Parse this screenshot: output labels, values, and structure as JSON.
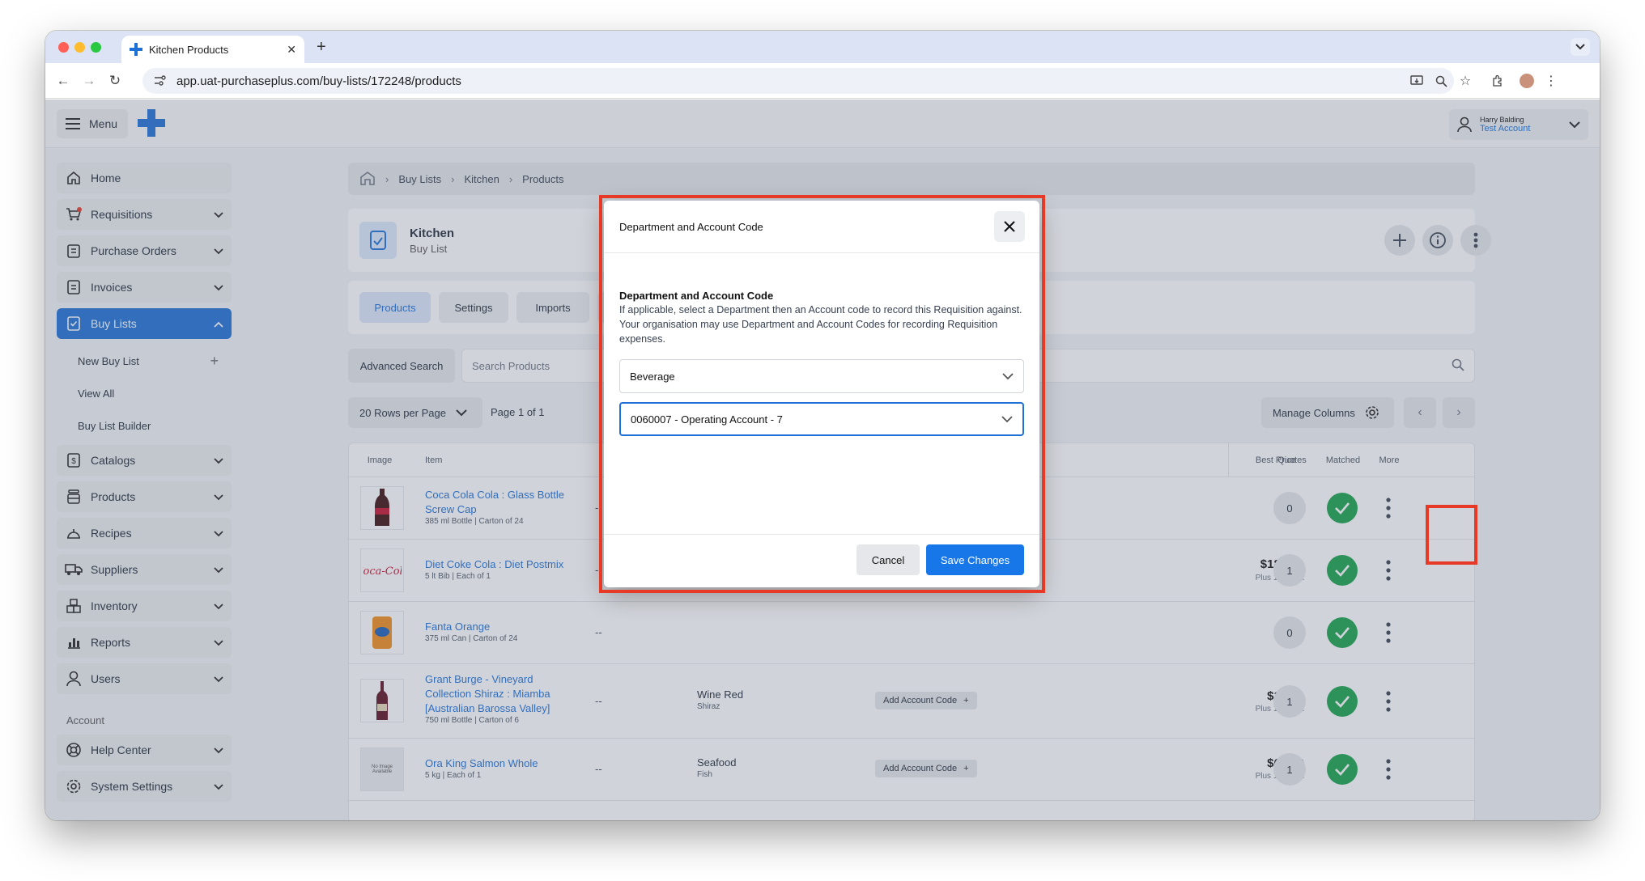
{
  "browser": {
    "tab_title": "Kitchen Products",
    "url": "app.uat-purchaseplus.com/buy-lists/172248/products"
  },
  "app": {
    "menu_label": "Menu",
    "user_name": "Harry Balding",
    "user_account": "Test Account",
    "colors": {
      "brand": "#1e6fd6",
      "success": "#16a34a",
      "highlight": "#e63a26"
    }
  },
  "sidebar": {
    "items": [
      {
        "label": "Home",
        "icon": "home-icon"
      },
      {
        "label": "Requisitions",
        "icon": "cart-icon"
      },
      {
        "label": "Purchase Orders",
        "icon": "clipboard-icon"
      },
      {
        "label": "Invoices",
        "icon": "document-icon"
      },
      {
        "label": "Buy Lists",
        "icon": "checklist-icon"
      }
    ],
    "buy_list_sub": [
      "New Buy List",
      "View All",
      "Buy List Builder"
    ],
    "items2": [
      {
        "label": "Catalogs",
        "icon": "catalog-icon"
      },
      {
        "label": "Products",
        "icon": "products-icon"
      },
      {
        "label": "Recipes",
        "icon": "recipe-icon"
      },
      {
        "label": "Suppliers",
        "icon": "truck-icon"
      },
      {
        "label": "Inventory",
        "icon": "inventory-icon"
      },
      {
        "label": "Reports",
        "icon": "chart-icon"
      },
      {
        "label": "Users",
        "icon": "user-icon"
      }
    ],
    "account_section": "Account",
    "account_items": [
      {
        "label": "Help Center",
        "icon": "lifebuoy-icon"
      },
      {
        "label": "System Settings",
        "icon": "gear-icon"
      }
    ]
  },
  "breadcrumb": [
    "Buy Lists",
    "Kitchen",
    "Products"
  ],
  "header": {
    "title": "Kitchen",
    "subtitle": "Buy List"
  },
  "tabs": [
    "Products",
    "Settings",
    "Imports"
  ],
  "search": {
    "advanced_label": "Advanced Search",
    "placeholder": "Search Products"
  },
  "pager": {
    "rows_label": "20 Rows per Page",
    "page_label": "Page 1 of 1",
    "manage_columns": "Manage Columns"
  },
  "table": {
    "headers": {
      "image": "Image",
      "item": "Item",
      "best_price": "Best Price",
      "quotes": "Quotes",
      "matched": "Matched",
      "more": "More"
    },
    "rows": [
      {
        "name": "Coca Cola Cola : Glass Bottle Screw Cap",
        "meta": "385 ml Bottle | Carton of 24",
        "dash": "--",
        "dept": "",
        "dept_sub": "",
        "account": "",
        "price": "--",
        "tax": "--",
        "quotes": "0"
      },
      {
        "name": "Diet Coke Cola : Diet Postmix",
        "meta": "5 lt Bib | Each of 1",
        "dash": "--",
        "dept": "",
        "dept_sub": "",
        "account": "",
        "price": "$184.71",
        "tax": "Plus 10% Tax",
        "quotes": "1"
      },
      {
        "name": "Fanta Orange",
        "meta": "375 ml Can | Carton of 24",
        "dash": "--",
        "dept": "",
        "dept_sub": "",
        "account": "",
        "price": "--",
        "tax": "--",
        "quotes": "0"
      },
      {
        "name": "Grant Burge - Vineyard Collection Shiraz : Miamba [Australian Barossa Valley]",
        "meta": "750 ml Bottle | Carton of 6",
        "dash": "--",
        "dept": "Wine Red",
        "dept_sub": "Shiraz",
        "account": "Add Account Code",
        "price": "$16.01",
        "tax": "Plus 15% Tax",
        "quotes": "1"
      },
      {
        "name": "Ora King Salmon Whole",
        "meta": "5 kg | Each of 1",
        "dash": "--",
        "dept": "Seafood",
        "dept_sub": "Fish",
        "account": "Add Account Code",
        "price": "$60.00",
        "tax": "Plus 15% Tax",
        "quotes": "1",
        "no_image": "No Image Available"
      }
    ]
  },
  "modal": {
    "title": "Department and Account Code",
    "label": "Department and Account Code",
    "description": "If applicable, select a Department then an Account code to record this Requisition against. Your organisation may use Department and Account Codes for recording Requisition expenses.",
    "department_value": "Beverage",
    "account_value": "0060007 - Operating Account - 7",
    "cancel_label": "Cancel",
    "save_label": "Save Changes"
  }
}
